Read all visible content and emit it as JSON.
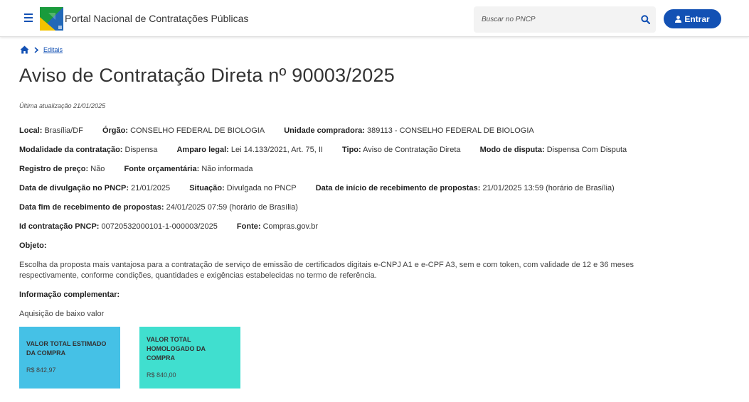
{
  "header": {
    "portal_title": "Portal Nacional de Contratações Públicas",
    "search_placeholder": "Buscar no PNCP",
    "login_label": "Entrar"
  },
  "breadcrumb": {
    "items": [
      "Editais"
    ]
  },
  "page": {
    "title": "Aviso de Contratação Direta nº 90003/2025",
    "updated": "Última atualização 21/01/2025"
  },
  "info": {
    "local_label": "Local:",
    "local_value": "Brasília/DF",
    "orgao_label": "Órgão:",
    "orgao_value": "CONSELHO FEDERAL DE BIOLOGIA",
    "unidade_label": "Unidade compradora:",
    "unidade_value": "389113 - CONSELHO FEDERAL DE BIOLOGIA",
    "modalidade_label": "Modalidade da contratação:",
    "modalidade_value": "Dispensa",
    "amparo_label": "Amparo legal:",
    "amparo_value": "Lei 14.133/2021, Art. 75, II",
    "tipo_label": "Tipo:",
    "tipo_value": "Aviso de Contratação Direta",
    "disputa_label": "Modo de disputa:",
    "disputa_value": "Dispensa Com Disputa",
    "registro_label": "Registro de preço:",
    "registro_value": "Não",
    "fonte_orc_label": "Fonte orçamentária:",
    "fonte_orc_value": "Não informada",
    "divulgacao_label": "Data de divulgação no PNCP:",
    "divulgacao_value": "21/01/2025",
    "situacao_label": "Situação:",
    "situacao_value": "Divulgada no PNCP",
    "inicio_label": "Data de início de recebimento de propostas:",
    "inicio_value": "21/01/2025 13:59 (horário de Brasília)",
    "fim_label": "Data fim de recebimento de propostas:",
    "fim_value": "24/01/2025 07:59 (horário de Brasília)",
    "id_label": "Id contratação PNCP:",
    "id_value": "00720532000101-1-000003/2025",
    "fonte_label": "Fonte:",
    "fonte_value": "Compras.gov.br"
  },
  "objeto": {
    "label": "Objeto:",
    "text": "Escolha da proposta mais vantajosa para a contratação de serviço de emissão de certificados digitais e-CNPJ A1 e e-CPF A3, sem e com token, com validade de 12 e 36 meses respectivamente, conforme condições, quantidades e exigências estabelecidas no termo de referência."
  },
  "complementar": {
    "label": "Informação complementar:",
    "text": "Aquisição de baixo valor"
  },
  "cards": [
    {
      "title": "VALOR TOTAL ESTIMADO DA COMPRA",
      "value": "R$ 842,97",
      "color": "#45c1e6"
    },
    {
      "title": "VALOR TOTAL HOMOLOGADO DA COMPRA",
      "value": "R$ 840,00",
      "color": "#40dfcf"
    }
  ],
  "colors": {
    "primary": "#1351b4"
  },
  "icons": [
    "menu-icon",
    "home-icon",
    "chevron-right-icon",
    "search-icon",
    "user-icon"
  ]
}
